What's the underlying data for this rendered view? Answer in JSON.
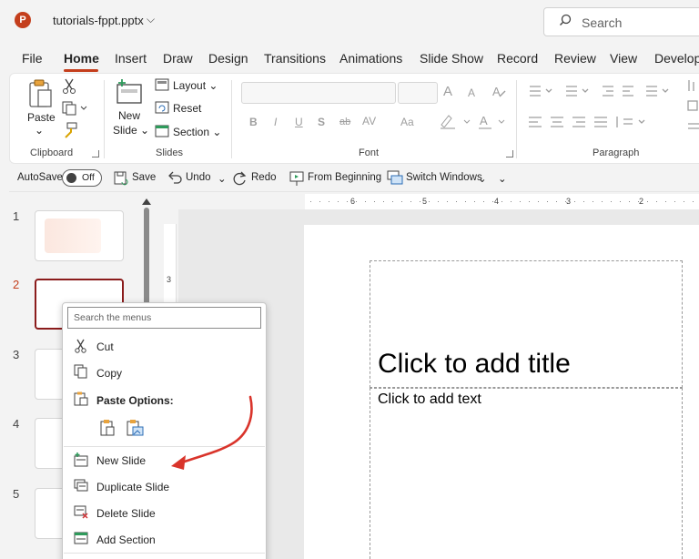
{
  "titlebar": {
    "app_icon": "P",
    "file_name": "tutorials-fppt.pptx",
    "chevron": "⌵",
    "search_placeholder": "Search"
  },
  "tabs": [
    "File",
    "Home",
    "Insert",
    "Draw",
    "Design",
    "Transitions",
    "Animations",
    "Slide Show",
    "Record",
    "Review",
    "View",
    "Develop"
  ],
  "ribbon": {
    "paste": "Paste",
    "paste_arrow": "⌄",
    "new_slide_1": "New",
    "new_slide_2": "Slide ⌄",
    "layout": "Layout ⌄",
    "reset": "Reset",
    "section": "Section ⌄",
    "bold": "B",
    "italic": "I",
    "underline": "U",
    "shadow": "S",
    "strike": "ab",
    "spacing": "AV",
    "case": "Aa",
    "grow": "A",
    "shrink": "A",
    "groups": {
      "clipboard": "Clipboard",
      "slides": "Slides",
      "font": "Font",
      "paragraph": "Paragraph"
    }
  },
  "qat": {
    "autosave": "AutoSave",
    "toggle": "Off",
    "save": "Save",
    "undo": "Undo",
    "redo": "Redo",
    "from_beginning": "From Beginning",
    "switch_windows": "Switch Windows",
    "chevron": "⌄",
    "more": "⌄"
  },
  "slides": [
    {
      "num": "1"
    },
    {
      "num": "2"
    },
    {
      "num": "3"
    },
    {
      "num": "4"
    },
    {
      "num": "5"
    }
  ],
  "ruler": {
    "h": [
      "6",
      "5",
      "4",
      "3",
      "2"
    ],
    "v": [
      "3"
    ]
  },
  "slide": {
    "title": "Click to add title",
    "body": "Click to add text"
  },
  "context_menu": {
    "search_placeholder": "Search the menus",
    "cut": "Cut",
    "copy": "Copy",
    "paste_options": "Paste Options:",
    "new_slide": "New Slide",
    "duplicate_slide": "Duplicate Slide",
    "delete_slide": "Delete Slide",
    "add_section": "Add Section"
  },
  "colors": {
    "accent": "#c43e1c",
    "annotation_arrow": "#d9342b"
  }
}
